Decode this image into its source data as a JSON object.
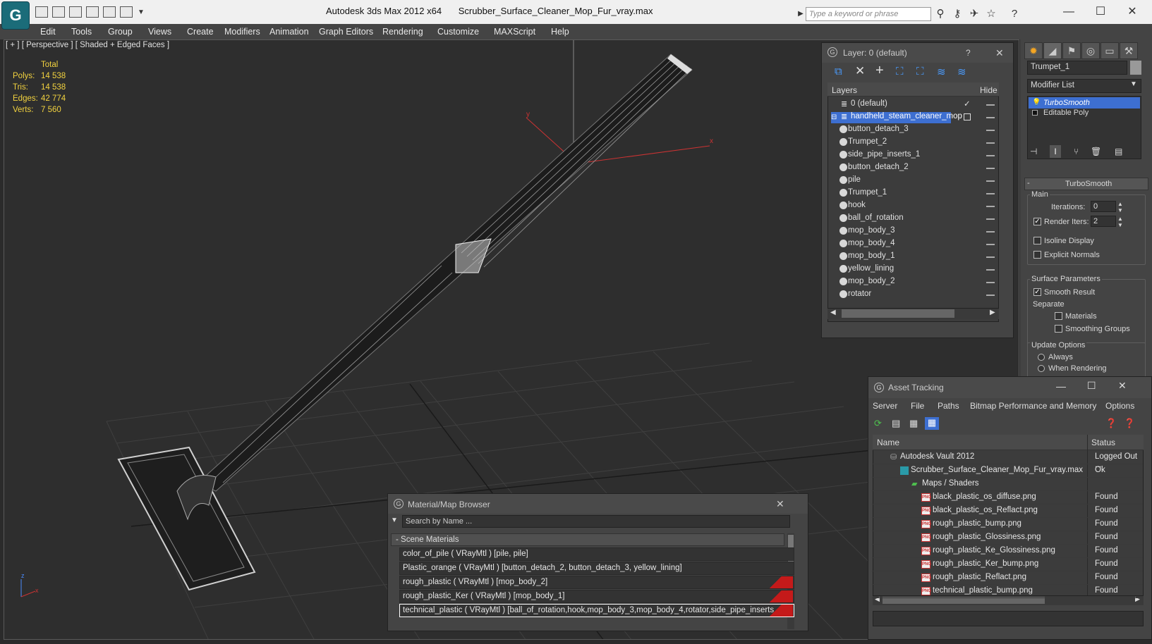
{
  "titlebar": {
    "app_title": "Autodesk 3ds Max  2012 x64",
    "file_title": "Scrubber_Surface_Cleaner_Mop_Fur_vray.max",
    "search_placeholder": "Type a keyword or phrase",
    "logo_glyph": "G"
  },
  "menubar": [
    "Edit",
    "Tools",
    "Group",
    "Views",
    "Create",
    "Modifiers",
    "Animation",
    "Graph Editors",
    "Rendering",
    "Customize",
    "MAXScript",
    "Help"
  ],
  "viewport": {
    "label": "[ + ] [ Perspective ] [ Shaded + Edged Faces ]",
    "stats": {
      "total_label": "Total",
      "rows": [
        {
          "label": "Polys:",
          "value": "14 538"
        },
        {
          "label": "Tris:",
          "value": "14 538"
        },
        {
          "label": "Edges:",
          "value": "42 774"
        },
        {
          "label": "Verts:",
          "value": "7 560"
        }
      ]
    },
    "gizmo_x": "x",
    "gizmo_y": "y",
    "axis_z": "z",
    "axis_x": "x"
  },
  "command_panel": {
    "object_name": "Trumpet_1",
    "modifier_list": "Modifier List",
    "stack": [
      "TurboSmooth",
      "Editable Poly"
    ],
    "rollout_title": "TurboSmooth",
    "main_label": "Main",
    "iterations_label": "Iterations:",
    "iterations_value": "0",
    "render_iters_label": "Render Iters:",
    "render_iters_value": "2",
    "isoline_label": "Isoline Display",
    "explicit_label": "Explicit Normals",
    "surface_params_label": "Surface Parameters",
    "smooth_result_label": "Smooth Result",
    "separate_label": "Separate",
    "materials_label": "Materials",
    "smoothing_groups_label": "Smoothing Groups",
    "update_options_label": "Update Options",
    "always_label": "Always",
    "when_rendering_label": "When Rendering"
  },
  "layer_dialog": {
    "title": "Layer: 0 (default)",
    "help": "?",
    "close": "✕",
    "col_layers": "Layers",
    "col_hide": "Hide",
    "layer_default": "0 (default)",
    "layer_selected": "handheld_steam_cleaner_mop",
    "objects": [
      "button_detach_3",
      "Trumpet_2",
      "side_pipe_inserts_1",
      "button_detach_2",
      "pile",
      "Trumpet_1",
      "hook",
      "ball_of_rotation",
      "mop_body_3",
      "mop_body_4",
      "mop_body_1",
      "yellow_lining",
      "mop_body_2",
      "rotator"
    ]
  },
  "material_browser": {
    "title": "Material/Map Browser",
    "search_placeholder": "Search by Name ...",
    "section": "- Scene Materials",
    "rows": [
      "color_of_pile  ( VRayMtl )  [pile, pile]",
      "Plastic_orange  ( VRayMtl )  [button_detach_2, button_detach_3, yellow_lining]",
      "rough_plastic  ( VRayMtl )  [mop_body_2]",
      "rough_plastic_Ker  ( VRayMtl )  [mop_body_1]",
      "technical_plastic ( VRayMtl ) [ball_of_rotation,hook,mop_body_3,mop_body_4,rotator,side_pipe_inserts..."
    ]
  },
  "asset_tracking": {
    "title": "Asset Tracking",
    "menu": [
      "Server",
      "File",
      "Paths",
      "Bitmap Performance and Memory",
      "Options"
    ],
    "col_name": "Name",
    "col_status": "Status",
    "rows": [
      {
        "name": "Autodesk Vault 2012",
        "status": "Logged Out ...",
        "indent": 0,
        "icon": "vault"
      },
      {
        "name": "Scrubber_Surface_Cleaner_Mop_Fur_vray.max",
        "status": "Ok",
        "indent": 1,
        "icon": "max"
      },
      {
        "name": "Maps / Shaders",
        "status": "",
        "indent": 2,
        "icon": "folder"
      },
      {
        "name": "black_plastic_os_diffuse.png",
        "status": "Found",
        "indent": 3,
        "icon": "png"
      },
      {
        "name": "black_plastic_os_Reflact.png",
        "status": "Found",
        "indent": 3,
        "icon": "png"
      },
      {
        "name": "rough_plastic_bump.png",
        "status": "Found",
        "indent": 3,
        "icon": "png"
      },
      {
        "name": "rough_plastic_Glossiness.png",
        "status": "Found",
        "indent": 3,
        "icon": "png"
      },
      {
        "name": "rough_plastic_Ke_Glossiness.png",
        "status": "Found",
        "indent": 3,
        "icon": "png"
      },
      {
        "name": "rough_plastic_Ker_bump.png",
        "status": "Found",
        "indent": 3,
        "icon": "png"
      },
      {
        "name": "rough_plastic_Reflact.png",
        "status": "Found",
        "indent": 3,
        "icon": "png"
      },
      {
        "name": "technical_plastic_bump.png",
        "status": "Found",
        "indent": 3,
        "icon": "png"
      }
    ],
    "png_tag": "PNG"
  },
  "colors": {
    "stats_yellow": "#f2d23f",
    "selection_blue": "#3d6fd1",
    "red_swatch": "#c41a1a"
  }
}
